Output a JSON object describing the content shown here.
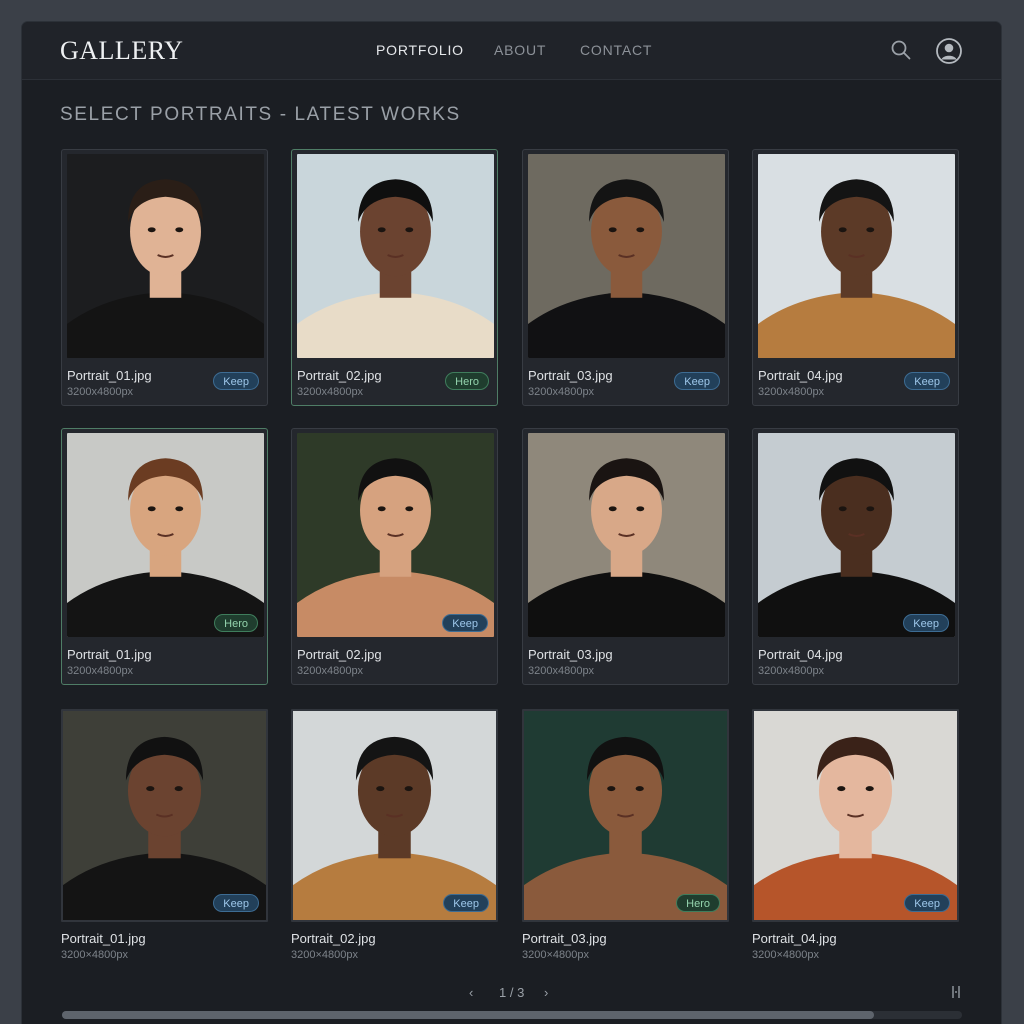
{
  "header": {
    "logo": "GALLERY",
    "nav": [
      "PORTFOLIO",
      "ABOUT",
      "CONTACT"
    ],
    "active_nav": "PORTFOLIO",
    "icons": [
      "search-icon",
      "user-icon"
    ]
  },
  "heading": "SELECT PORTRAITS - LATEST WORKS",
  "grid": {
    "rows": [
      [
        {
          "file": "Portrait_01.jpg",
          "dims": "3200x4800px",
          "badge": "Keep"
        },
        {
          "file": "Portrait_02.jpg",
          "dims": "3200x4800px",
          "badge": "Hero"
        },
        {
          "file": "Portrait_03.jpg",
          "dims": "3200x4800px",
          "badge": "Keep"
        },
        {
          "file": "Portrait_04.jpg",
          "dims": "3200x4800px",
          "badge": "Keep"
        }
      ],
      [
        {
          "file": "Portrait_01.jpg",
          "dims": "3200x4800px",
          "badge": "Hero"
        },
        {
          "file": "Portrait_02.jpg",
          "dims": "3200x4800px",
          "badge": "Keep"
        },
        {
          "file": "Portrait_03.jpg",
          "dims": "3200x4800px",
          "badge": ""
        },
        {
          "file": "Portrait_04.jpg",
          "dims": "3200x4800px",
          "badge": "Keep"
        }
      ],
      [
        {
          "file": "Portrait_01.jpg",
          "dims": "3200×4800px",
          "badge": "Keep"
        },
        {
          "file": "Portrait_02.jpg",
          "dims": "3200×4800px",
          "badge": "Keep"
        },
        {
          "file": "Portrait_03.jpg",
          "dims": "3200×4800px",
          "badge": "Hero"
        },
        {
          "file": "Portrait_04.jpg",
          "dims": "3200×4800px",
          "badge": "Keep"
        }
      ]
    ]
  },
  "pager": {
    "prev": "‹",
    "label": "1 / 3",
    "next": "›"
  },
  "colors": {
    "keep_badge": "#22405a",
    "hero_badge": "#1f3d2e",
    "hero_border": "#4f7d66",
    "background": "#1b1e23"
  }
}
